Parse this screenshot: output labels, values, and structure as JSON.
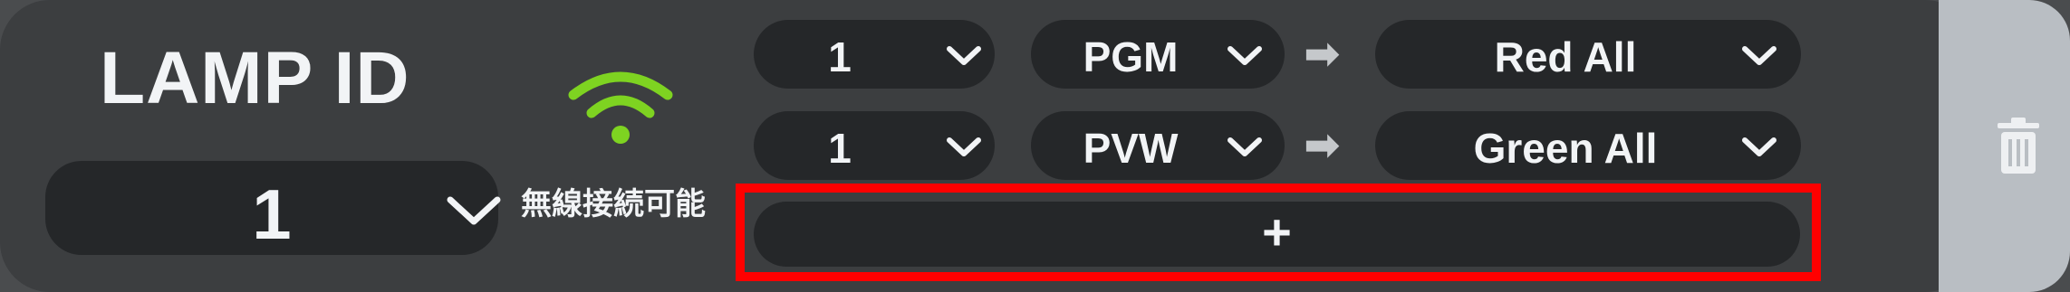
{
  "lamp": {
    "title": "LAMP ID",
    "selected_id": "1"
  },
  "wireless": {
    "status_label": "無線接続可能",
    "color": "#7ed321"
  },
  "mappings": [
    {
      "source_num": "1",
      "source_type": "PGM",
      "arrow": "➡",
      "action": "Red All"
    },
    {
      "source_num": "1",
      "source_type": "PVW",
      "arrow": "➡",
      "action": "Green All"
    }
  ],
  "add_button": {
    "label": "+"
  },
  "highlight_color": "#ff0000"
}
